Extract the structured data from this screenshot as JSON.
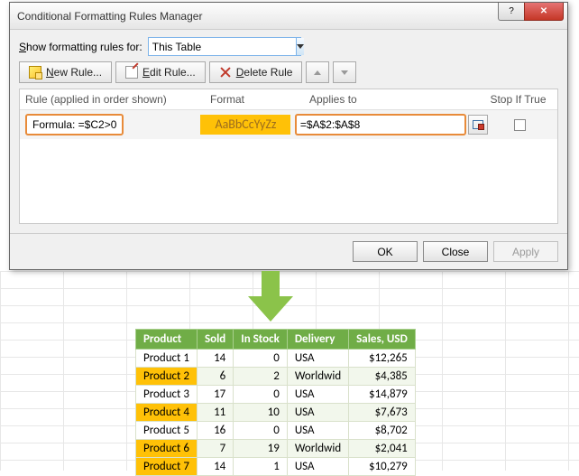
{
  "dialog": {
    "title": "Conditional Formatting Rules Manager",
    "show_label_pre": "S",
    "show_label_mid": "how formatting rules for:",
    "scope_value": "This Table",
    "btn_new": "New Rule...",
    "btn_edit": "Edit Rule...",
    "btn_delete": "Delete Rule",
    "col_rule": "Rule (applied in order shown)",
    "col_format": "Format",
    "col_applies": "Applies to",
    "col_stop": "Stop If True",
    "rule_text": "Formula: =$C2>0",
    "format_sample": "AaBbCcYyZz",
    "applies_value": "=$A$2:$A$8",
    "btn_ok": "OK",
    "btn_close": "Close",
    "btn_apply": "Apply"
  },
  "table": {
    "headers": [
      "Product",
      "Sold",
      "In Stock",
      "Delivery",
      "Sales,  USD"
    ],
    "rows": [
      {
        "p": "Product 1",
        "sold": "14",
        "stock": "0",
        "del": "USA",
        "sales": "$12,265",
        "hl": false,
        "alt": false
      },
      {
        "p": "Product 2",
        "sold": "6",
        "stock": "2",
        "del": "Worldwid",
        "sales": "$4,385",
        "hl": true,
        "alt": true
      },
      {
        "p": "Product 3",
        "sold": "17",
        "stock": "0",
        "del": "USA",
        "sales": "$14,879",
        "hl": false,
        "alt": false
      },
      {
        "p": "Product 4",
        "sold": "11",
        "stock": "10",
        "del": "USA",
        "sales": "$7,673",
        "hl": true,
        "alt": true
      },
      {
        "p": "Product 5",
        "sold": "16",
        "stock": "0",
        "del": "USA",
        "sales": "$8,702",
        "hl": false,
        "alt": false
      },
      {
        "p": "Product 6",
        "sold": "7",
        "stock": "19",
        "del": "Worldwid",
        "sales": "$2,041",
        "hl": true,
        "alt": true
      },
      {
        "p": "Product 7",
        "sold": "14",
        "stock": "1",
        "del": "USA",
        "sales": "$10,279",
        "hl": true,
        "alt": false
      }
    ]
  }
}
